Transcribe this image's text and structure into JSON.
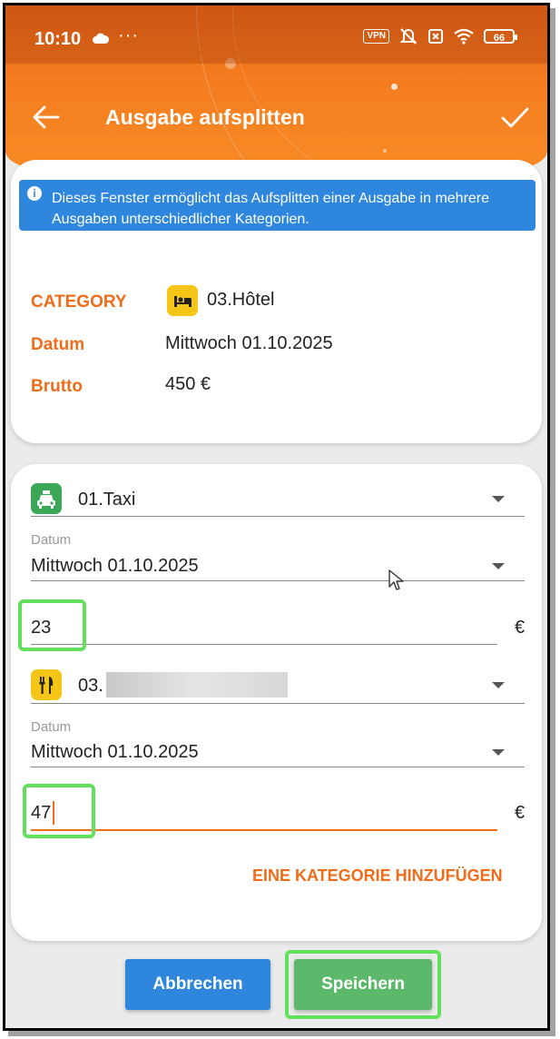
{
  "status_bar": {
    "time": "10:10",
    "vpn": "VPN",
    "battery": "66"
  },
  "header": {
    "title": "Ausgabe aufsplitten"
  },
  "info": {
    "text": "Dieses Fenster ermöglicht das Aufsplitten einer Ausgabe in mehrere Ausgaben unterschiedlicher Kategorien."
  },
  "summary": {
    "category_label": "CATEGORY",
    "category_value": "03.Hôtel",
    "date_label": "Datum",
    "date_value": "Mittwoch 01.10.2025",
    "gross_label": "Brutto",
    "gross_value": "450 €"
  },
  "splits": [
    {
      "category": "01.Taxi",
      "date_caption": "Datum",
      "date_value": "Mittwoch 01.10.2025",
      "amount": "23",
      "currency": "€"
    },
    {
      "category": "03.",
      "date_caption": "Datum",
      "date_value": "Mittwoch 01.10.2025",
      "amount": "47",
      "currency": "€"
    }
  ],
  "add_category_label": "EINE KATEGORIE HINZUFÜGEN",
  "buttons": {
    "cancel": "Abbrechen",
    "save": "Speichern"
  },
  "colors": {
    "accent": "#ef6c1a",
    "primary_blue": "#2e87dd",
    "save_green": "#5cb86a",
    "highlight_green": "#63e05b",
    "taxi_icon": "#3aa856",
    "hotel_icon": "#f5c518"
  }
}
